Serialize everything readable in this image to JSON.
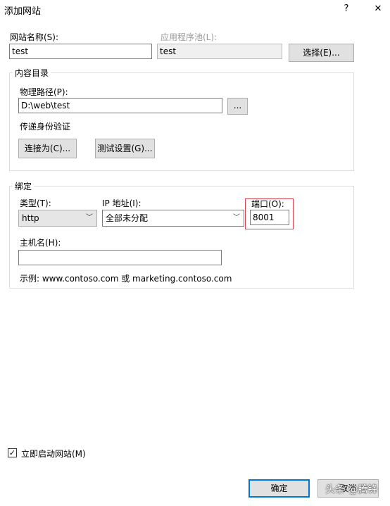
{
  "window": {
    "title": "添加网站",
    "help_label": "?",
    "close_label": "✕"
  },
  "site_name": {
    "label": "网站名称(S):",
    "value": "test"
  },
  "app_pool": {
    "label": "应用程序池(L):",
    "value": "test",
    "select_button": "选择(E)..."
  },
  "content_dir": {
    "group_title": "内容目录",
    "physical_path_label": "物理路径(P):",
    "physical_path_value": "D:\\web\\test",
    "browse_button": "...",
    "pass_through_auth": "传递身份验证",
    "connect_as_button": "连接为(C)...",
    "test_settings_button": "测试设置(G)..."
  },
  "binding": {
    "group_title": "绑定",
    "type_label": "类型(T):",
    "type_value": "http",
    "ip_label": "IP 地址(I):",
    "ip_value": "全部未分配",
    "port_label": "端口(O):",
    "port_value": "8001",
    "hostname_label": "主机名(H):",
    "hostname_value": "",
    "example": "示例: www.contoso.com 或 marketing.contoso.com"
  },
  "start_immediately": {
    "label": "立即启动网站(M)",
    "checked": true,
    "check_glyph": "✓"
  },
  "footer": {
    "ok_button": "确定",
    "cancel_button": "取消"
  },
  "watermark": "头条 @腾锋",
  "icons": {
    "dropdown": "chevron-down-icon"
  }
}
